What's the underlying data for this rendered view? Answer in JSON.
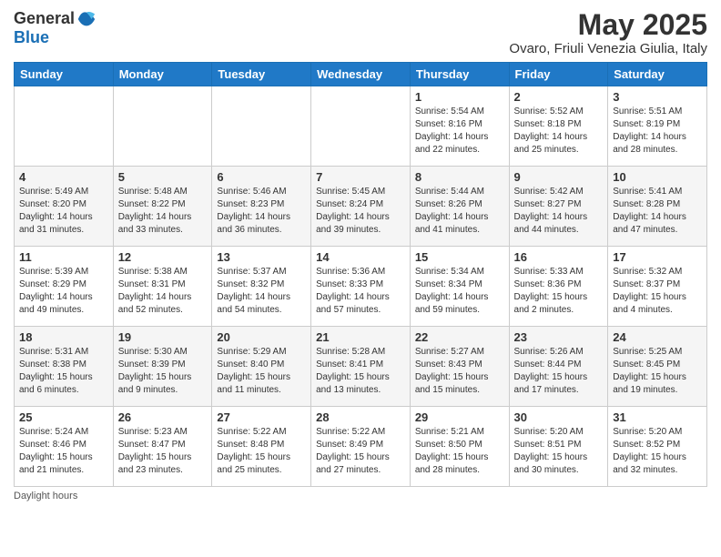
{
  "logo": {
    "text_general": "General",
    "text_blue": "Blue"
  },
  "header": {
    "month_year": "May 2025",
    "location": "Ovaro, Friuli Venezia Giulia, Italy"
  },
  "weekdays": [
    "Sunday",
    "Monday",
    "Tuesday",
    "Wednesday",
    "Thursday",
    "Friday",
    "Saturday"
  ],
  "weeks": [
    [
      {
        "day": "",
        "info": ""
      },
      {
        "day": "",
        "info": ""
      },
      {
        "day": "",
        "info": ""
      },
      {
        "day": "",
        "info": ""
      },
      {
        "day": "1",
        "info": "Sunrise: 5:54 AM\nSunset: 8:16 PM\nDaylight: 14 hours\nand 22 minutes."
      },
      {
        "day": "2",
        "info": "Sunrise: 5:52 AM\nSunset: 8:18 PM\nDaylight: 14 hours\nand 25 minutes."
      },
      {
        "day": "3",
        "info": "Sunrise: 5:51 AM\nSunset: 8:19 PM\nDaylight: 14 hours\nand 28 minutes."
      }
    ],
    [
      {
        "day": "4",
        "info": "Sunrise: 5:49 AM\nSunset: 8:20 PM\nDaylight: 14 hours\nand 31 minutes."
      },
      {
        "day": "5",
        "info": "Sunrise: 5:48 AM\nSunset: 8:22 PM\nDaylight: 14 hours\nand 33 minutes."
      },
      {
        "day": "6",
        "info": "Sunrise: 5:46 AM\nSunset: 8:23 PM\nDaylight: 14 hours\nand 36 minutes."
      },
      {
        "day": "7",
        "info": "Sunrise: 5:45 AM\nSunset: 8:24 PM\nDaylight: 14 hours\nand 39 minutes."
      },
      {
        "day": "8",
        "info": "Sunrise: 5:44 AM\nSunset: 8:26 PM\nDaylight: 14 hours\nand 41 minutes."
      },
      {
        "day": "9",
        "info": "Sunrise: 5:42 AM\nSunset: 8:27 PM\nDaylight: 14 hours\nand 44 minutes."
      },
      {
        "day": "10",
        "info": "Sunrise: 5:41 AM\nSunset: 8:28 PM\nDaylight: 14 hours\nand 47 minutes."
      }
    ],
    [
      {
        "day": "11",
        "info": "Sunrise: 5:39 AM\nSunset: 8:29 PM\nDaylight: 14 hours\nand 49 minutes."
      },
      {
        "day": "12",
        "info": "Sunrise: 5:38 AM\nSunset: 8:31 PM\nDaylight: 14 hours\nand 52 minutes."
      },
      {
        "day": "13",
        "info": "Sunrise: 5:37 AM\nSunset: 8:32 PM\nDaylight: 14 hours\nand 54 minutes."
      },
      {
        "day": "14",
        "info": "Sunrise: 5:36 AM\nSunset: 8:33 PM\nDaylight: 14 hours\nand 57 minutes."
      },
      {
        "day": "15",
        "info": "Sunrise: 5:34 AM\nSunset: 8:34 PM\nDaylight: 14 hours\nand 59 minutes."
      },
      {
        "day": "16",
        "info": "Sunrise: 5:33 AM\nSunset: 8:36 PM\nDaylight: 15 hours\nand 2 minutes."
      },
      {
        "day": "17",
        "info": "Sunrise: 5:32 AM\nSunset: 8:37 PM\nDaylight: 15 hours\nand 4 minutes."
      }
    ],
    [
      {
        "day": "18",
        "info": "Sunrise: 5:31 AM\nSunset: 8:38 PM\nDaylight: 15 hours\nand 6 minutes."
      },
      {
        "day": "19",
        "info": "Sunrise: 5:30 AM\nSunset: 8:39 PM\nDaylight: 15 hours\nand 9 minutes."
      },
      {
        "day": "20",
        "info": "Sunrise: 5:29 AM\nSunset: 8:40 PM\nDaylight: 15 hours\nand 11 minutes."
      },
      {
        "day": "21",
        "info": "Sunrise: 5:28 AM\nSunset: 8:41 PM\nDaylight: 15 hours\nand 13 minutes."
      },
      {
        "day": "22",
        "info": "Sunrise: 5:27 AM\nSunset: 8:43 PM\nDaylight: 15 hours\nand 15 minutes."
      },
      {
        "day": "23",
        "info": "Sunrise: 5:26 AM\nSunset: 8:44 PM\nDaylight: 15 hours\nand 17 minutes."
      },
      {
        "day": "24",
        "info": "Sunrise: 5:25 AM\nSunset: 8:45 PM\nDaylight: 15 hours\nand 19 minutes."
      }
    ],
    [
      {
        "day": "25",
        "info": "Sunrise: 5:24 AM\nSunset: 8:46 PM\nDaylight: 15 hours\nand 21 minutes."
      },
      {
        "day": "26",
        "info": "Sunrise: 5:23 AM\nSunset: 8:47 PM\nDaylight: 15 hours\nand 23 minutes."
      },
      {
        "day": "27",
        "info": "Sunrise: 5:22 AM\nSunset: 8:48 PM\nDaylight: 15 hours\nand 25 minutes."
      },
      {
        "day": "28",
        "info": "Sunrise: 5:22 AM\nSunset: 8:49 PM\nDaylight: 15 hours\nand 27 minutes."
      },
      {
        "day": "29",
        "info": "Sunrise: 5:21 AM\nSunset: 8:50 PM\nDaylight: 15 hours\nand 28 minutes."
      },
      {
        "day": "30",
        "info": "Sunrise: 5:20 AM\nSunset: 8:51 PM\nDaylight: 15 hours\nand 30 minutes."
      },
      {
        "day": "31",
        "info": "Sunrise: 5:20 AM\nSunset: 8:52 PM\nDaylight: 15 hours\nand 32 minutes."
      }
    ]
  ],
  "footer": {
    "note": "Daylight hours"
  }
}
